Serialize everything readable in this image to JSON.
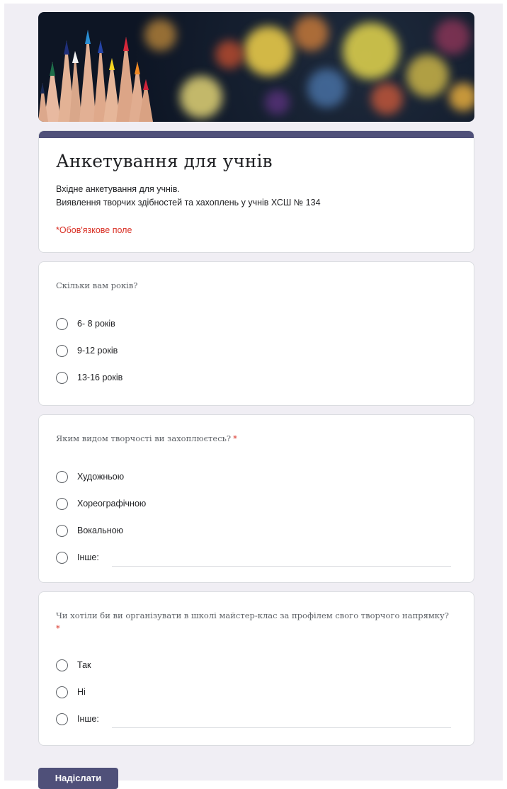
{
  "form": {
    "title": "Анкетування для учнів",
    "description_lines": [
      "Вхідне анкетування для учнів.",
      "Виявлення творчих здібностей  та хахоплень у учнів ХСШ № 134"
    ],
    "required_note": "*Обов'язкове поле"
  },
  "questions": [
    {
      "title": "Скільки вам років?",
      "required": false,
      "options": [
        "6- 8 років",
        "9-12 років",
        "13-16 років"
      ]
    },
    {
      "title": "Яким видом творчості ви захоплюєтесь?",
      "required": true,
      "required_mark": "*",
      "options": [
        "Художньою",
        "Хореографічною",
        "Вокальною"
      ],
      "other_label": "Інше:"
    },
    {
      "title": "Чи хотіли би ви організувати в школі майстер-клас за профілем свого творчого напрямку?",
      "required": true,
      "required_mark": "*",
      "options": [
        "Так",
        "Ні"
      ],
      "other_label": "Інше:"
    }
  ],
  "submit_label": "Надіслати",
  "colors": {
    "accent": "#4f5079",
    "required": "#d93025",
    "background": "#f0eef4"
  }
}
